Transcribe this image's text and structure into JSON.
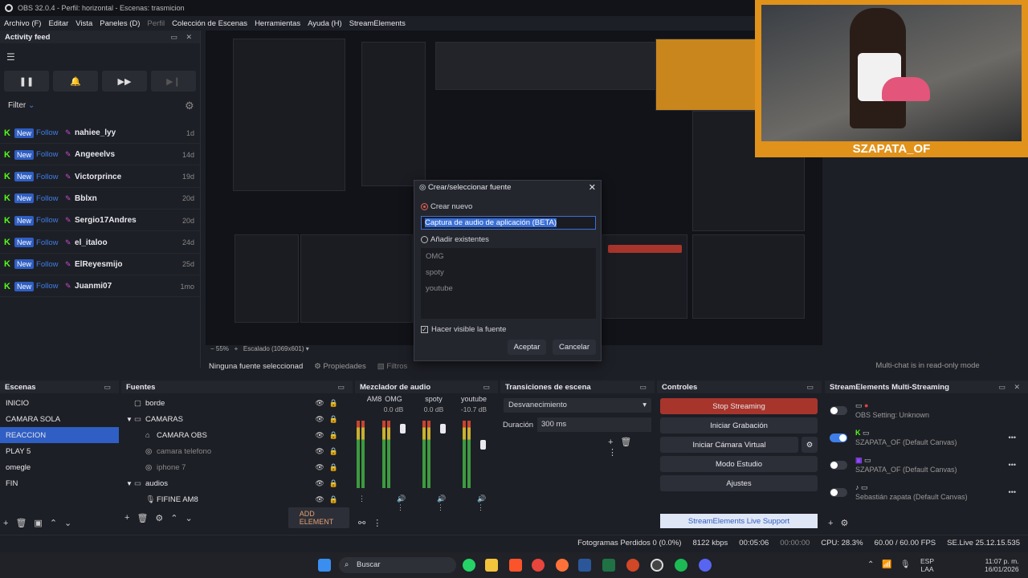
{
  "window": {
    "title": "OBS 32.0.4 - Perfil: horizontal - Escenas: trasmicion"
  },
  "menu": [
    "Archivo (F)",
    "Editar",
    "Vista",
    "Paneles (D)",
    "Perfil",
    "Colección de Escenas",
    "Herramientas",
    "Ayuda (H)",
    "StreamElements"
  ],
  "activity": {
    "title": "Activity feed",
    "filter": "Filter",
    "badge": "New",
    "action": "Follow",
    "items": [
      {
        "name": "nahiee_lyy",
        "time": "1d"
      },
      {
        "name": "Angeeelvs",
        "time": "14d"
      },
      {
        "name": "Victorprince",
        "time": "19d"
      },
      {
        "name": "Bblxn",
        "time": "20d"
      },
      {
        "name": "Sergio17Andres",
        "time": "20d"
      },
      {
        "name": "el_italoo",
        "time": "24d"
      },
      {
        "name": "ElReyesmijo",
        "time": "25d"
      },
      {
        "name": "Juanmi07",
        "time": "1mo"
      }
    ]
  },
  "camera": {
    "label": "SZAPATA_OF"
  },
  "chat": {
    "readonly": "Multi-chat is in read-only mode"
  },
  "dialog": {
    "title": "Crear/seleccionar fuente",
    "create_new": "Crear nuevo",
    "input_value": "Captura de audio de aplicación (BETA)",
    "add_existing": "Añadir existentes",
    "existing": [
      "OMG",
      "spoty",
      "youtube"
    ],
    "visible": "Hacer visible la fuente",
    "ok": "Aceptar",
    "cancel": "Cancelar"
  },
  "preview_bar": {
    "no_source": "Ninguna fuente seleccionad",
    "properties": "Propiedades",
    "filters": "Filtros"
  },
  "scenes": {
    "title": "Escenas",
    "items": [
      "INICIO",
      "CAMARA SOLA",
      "REACCION",
      "PLAY 5",
      "omegle",
      "FIN"
    ],
    "selected": "REACCION"
  },
  "sources": {
    "title": "Fuentes",
    "items": [
      "borde",
      "CAMARAS",
      "CAMARA OBS",
      "camara telefono",
      "iphone 7",
      "audios",
      "FIFINE AM8"
    ],
    "add": "ADD ELEMENT"
  },
  "mixer": {
    "title": "Mezclador de audio",
    "channels": [
      {
        "name": "AM8",
        "db": ""
      },
      {
        "name": "OMG",
        "db": "0.0 dB"
      },
      {
        "name": "spoty",
        "db": "0.0 dB"
      },
      {
        "name": "youtube",
        "db": "-10.7 dB"
      }
    ]
  },
  "transitions": {
    "title": "Transiciones de escena",
    "selected": "Desvanecimiento",
    "duration_label": "Duración",
    "duration": "300 ms"
  },
  "controls": {
    "title": "Controles",
    "stop": "Stop Streaming",
    "record": "Iniciar Grabación",
    "vcam": "Iniciar Cámara Virtual",
    "studio": "Modo Estudio",
    "settings": "Ajustes",
    "support": "StreamElements Live Support"
  },
  "multistream": {
    "title": "StreamElements Multi-Streaming",
    "rows": [
      {
        "name": "OBS Setting: Unknown",
        "on": false
      },
      {
        "name": "SZAPATA_OF (Default Canvas)",
        "on": true
      },
      {
        "name": "SZAPATA_OF (Default Canvas)",
        "on": false
      },
      {
        "name": "Sebastián zapata (Default Canvas)",
        "on": false
      }
    ]
  },
  "status": {
    "frames": "Fotogramas Perdidos 0 (0.0%)",
    "kbps": "8122 kbps",
    "time1": "00:05:06",
    "time2": "00:00:00",
    "cpu": "CPU: 28.3%",
    "fps": "60.00 / 60.00 FPS",
    "version": "SE.Live 25.12.15.535"
  },
  "taskbar": {
    "search": "Buscar",
    "lang": "ESP",
    "layout": "LAA",
    "time": "11:07 p. m.",
    "date": "16/01/2026"
  },
  "colors": {
    "accent": "#2f5fc4",
    "stop": "#a8352c",
    "kick": "#53fc18",
    "camera_frame": "#e0921a"
  }
}
